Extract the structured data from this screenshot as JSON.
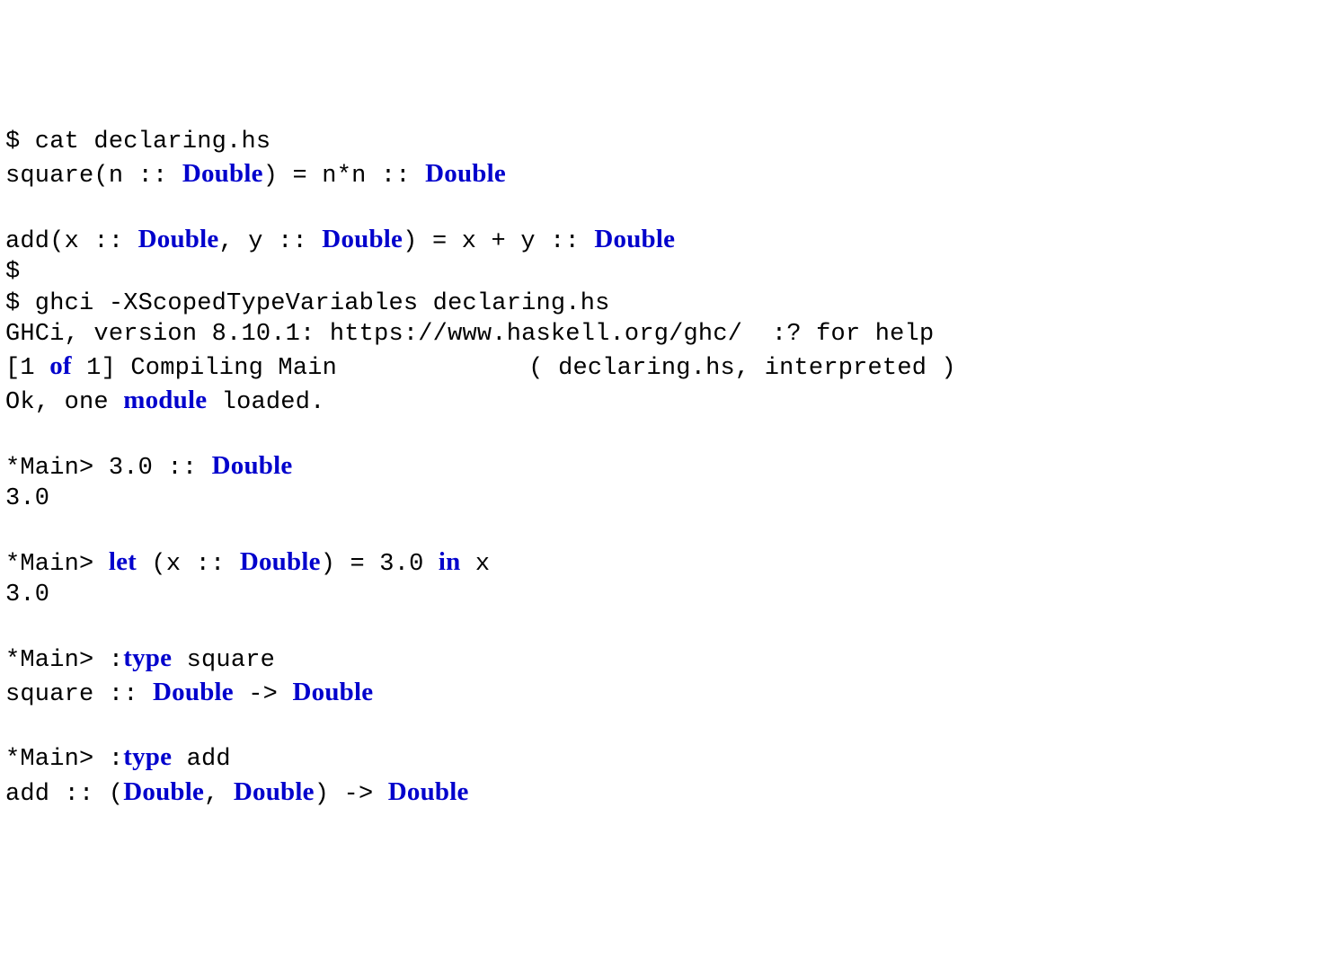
{
  "lines": [
    {
      "segments": [
        {
          "t": "$ cat declaring.hs"
        }
      ]
    },
    {
      "segments": [
        {
          "t": "square(n :: "
        },
        {
          "t": "Double",
          "k": true
        },
        {
          "t": ") = n*n :: "
        },
        {
          "t": "Double",
          "k": true
        }
      ]
    },
    {
      "segments": [
        {
          "t": ""
        }
      ]
    },
    {
      "segments": [
        {
          "t": "add(x :: "
        },
        {
          "t": "Double",
          "k": true
        },
        {
          "t": ", y :: "
        },
        {
          "t": "Double",
          "k": true
        },
        {
          "t": ") = x + y :: "
        },
        {
          "t": "Double",
          "k": true
        }
      ]
    },
    {
      "segments": [
        {
          "t": "$"
        }
      ]
    },
    {
      "segments": [
        {
          "t": "$ ghci -XScopedTypeVariables declaring.hs"
        }
      ]
    },
    {
      "segments": [
        {
          "t": "GHCi, version 8.10.1: https://www.haskell.org/ghc/  :? for help"
        }
      ]
    },
    {
      "segments": [
        {
          "t": "[1 "
        },
        {
          "t": "of",
          "k": true
        },
        {
          "t": " 1] Compiling Main             ( declaring.hs, interpreted )"
        }
      ]
    },
    {
      "segments": [
        {
          "t": "Ok, one "
        },
        {
          "t": "module",
          "k": true
        },
        {
          "t": " loaded."
        }
      ]
    },
    {
      "segments": [
        {
          "t": ""
        }
      ]
    },
    {
      "segments": [
        {
          "t": "*Main> 3.0 :: "
        },
        {
          "t": "Double",
          "k": true
        }
      ]
    },
    {
      "segments": [
        {
          "t": "3.0"
        }
      ]
    },
    {
      "segments": [
        {
          "t": ""
        }
      ]
    },
    {
      "segments": [
        {
          "t": "*Main> "
        },
        {
          "t": "let",
          "k": true
        },
        {
          "t": " (x :: "
        },
        {
          "t": "Double",
          "k": true
        },
        {
          "t": ") = 3.0 "
        },
        {
          "t": "in",
          "k": true
        },
        {
          "t": " x"
        }
      ]
    },
    {
      "segments": [
        {
          "t": "3.0"
        }
      ]
    },
    {
      "segments": [
        {
          "t": ""
        }
      ]
    },
    {
      "segments": [
        {
          "t": "*Main> :"
        },
        {
          "t": "type",
          "k": true
        },
        {
          "t": " square"
        }
      ]
    },
    {
      "segments": [
        {
          "t": "square :: "
        },
        {
          "t": "Double",
          "k": true
        },
        {
          "t": " -> "
        },
        {
          "t": "Double",
          "k": true
        }
      ]
    },
    {
      "segments": [
        {
          "t": ""
        }
      ]
    },
    {
      "segments": [
        {
          "t": "*Main> :"
        },
        {
          "t": "type",
          "k": true
        },
        {
          "t": " add"
        }
      ]
    },
    {
      "segments": [
        {
          "t": "add :: ("
        },
        {
          "t": "Double",
          "k": true
        },
        {
          "t": ", "
        },
        {
          "t": "Double",
          "k": true
        },
        {
          "t": ") -> "
        },
        {
          "t": "Double",
          "k": true
        }
      ]
    }
  ]
}
